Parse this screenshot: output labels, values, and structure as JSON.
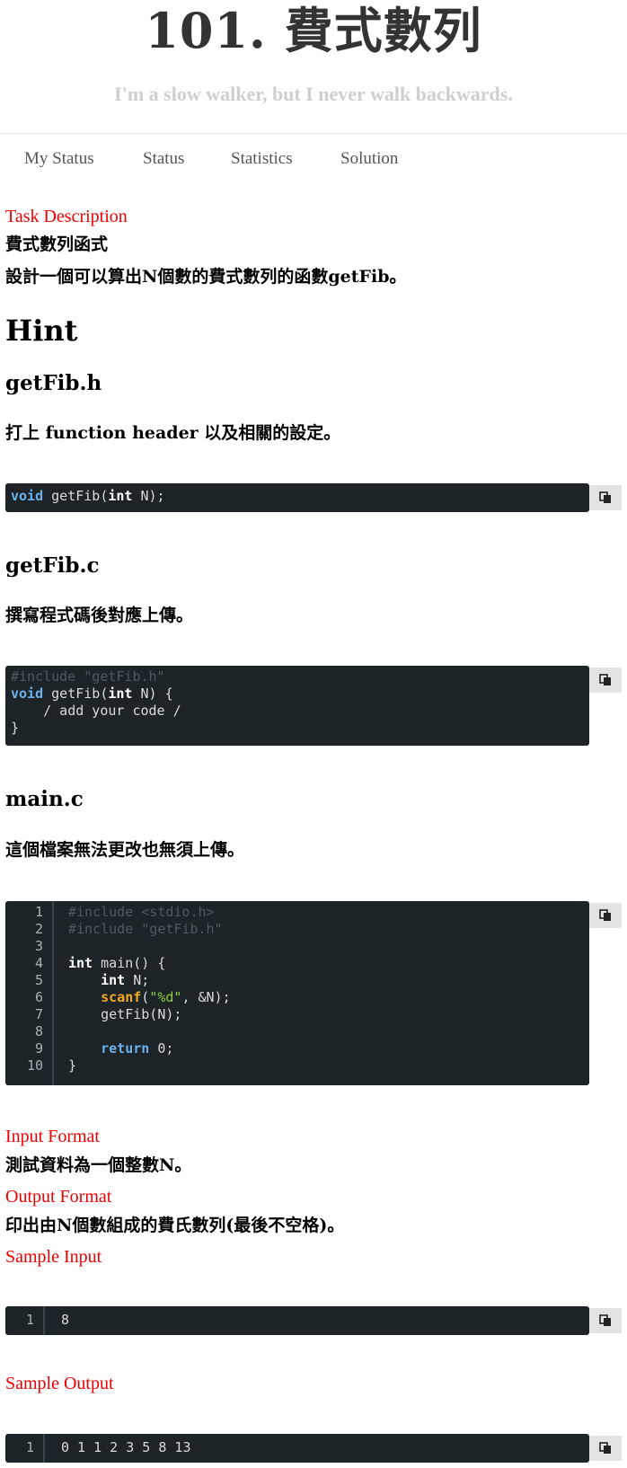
{
  "header": {
    "title": "101. 費式數列",
    "subtitle": "I'm a slow walker, but I never walk backwards."
  },
  "nav": {
    "items": [
      "My Status",
      "Status",
      "Statistics",
      "Solution"
    ]
  },
  "task": {
    "description_label": "Task Description",
    "name": "費式數列函式",
    "text": "設計一個可以算出N個數的費式數列的函數getFib。"
  },
  "hint": {
    "heading": "Hint",
    "header_file": {
      "name": "getFib.h",
      "desc": "打上 function header 以及相關的設定。",
      "code": {
        "kw1": "void",
        "t1": " getFib(",
        "kw2": "int",
        "t2": " N);"
      }
    },
    "source_file": {
      "name": "getFib.c",
      "desc": "撰寫程式碼後對應上傳。",
      "code": {
        "line1": "#include \"getFib.h\"",
        "l2_kw1": "void",
        "l2_t1": " getFib(",
        "l2_kw2": "int",
        "l2_t2": " N) {",
        "line3": "    / add your code /",
        "line4": "}"
      }
    },
    "main_file": {
      "name": "main.c",
      "desc": "這個檔案無法更改也無須上傳。",
      "line_numbers": [
        "1",
        "2",
        "3",
        "4",
        "5",
        "6",
        "7",
        "8",
        "9",
        "10"
      ],
      "code": {
        "l1": "#include <stdio.h>",
        "l2": "#include \"getFib.h\"",
        "l4_kw": "int",
        "l4_t": " main() {",
        "l5_kw": "int",
        "l5_t": " N;",
        "l6_fn": "scanf",
        "l6_p1": "(",
        "l6_str": "\"%d\"",
        "l6_p2": ", &N);",
        "l7": "    getFib(N);",
        "l9_kw": "return",
        "l9_t": " 0;",
        "l10": "}"
      }
    }
  },
  "input_format": {
    "label": "Input Format",
    "text": "測試資料為一個整數N。"
  },
  "output_format": {
    "label": "Output Format",
    "text": "印出由N個數組成的費氏數列(最後不空格)。"
  },
  "sample_input": {
    "label": "Sample Input",
    "line_no": "1",
    "value": "8"
  },
  "sample_output": {
    "label": "Sample Output",
    "line_no": "1",
    "value": "0 1 1 2 3 5 8 13"
  }
}
